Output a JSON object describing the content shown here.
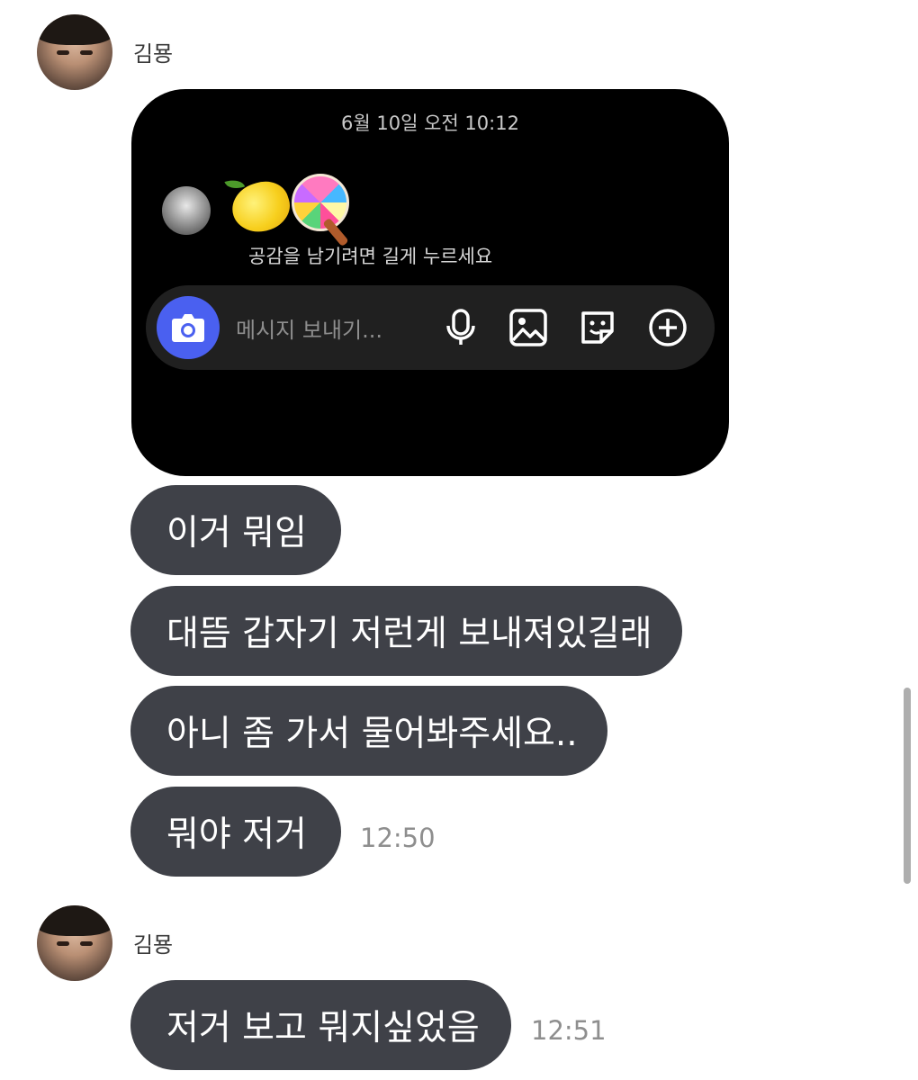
{
  "chat": {
    "messages_group_1": {
      "sender": "김묭",
      "image": {
        "date": "6월 10일 오전 10:12",
        "hint": "공감을 남기려면 길게 누르세요",
        "input_placeholder": "메시지 보내기..."
      },
      "bubbles": [
        "이거 뭐임",
        "대뜸 갑자기 저런게 보내져있길래",
        "아니 좀 가서 물어봐주세요..",
        "뭐야 저거"
      ],
      "time": "12:50"
    },
    "messages_group_2": {
      "sender": "김묭",
      "bubble": "저거 보고 뭐지싶었음",
      "time": "12:51"
    }
  }
}
